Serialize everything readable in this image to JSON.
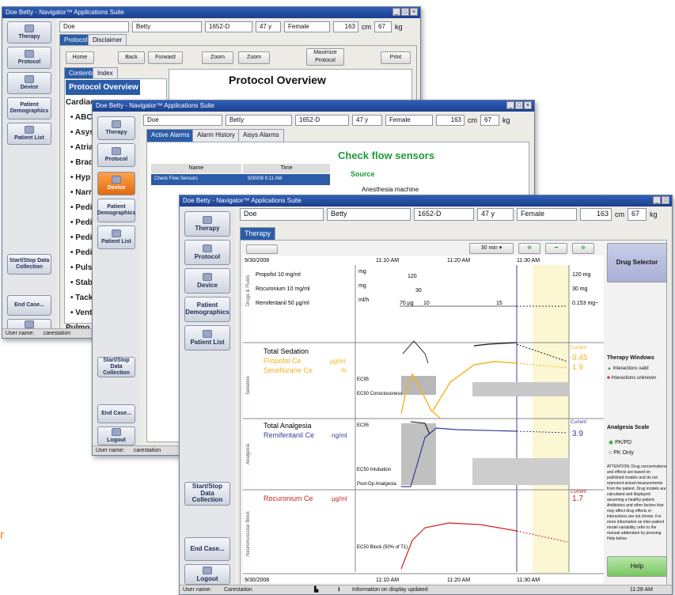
{
  "app_title": "Doe Betty - Navigator™ Applications Suite",
  "patient": {
    "last": "Doe",
    "first": "Betty",
    "id": "1652-D",
    "age": "47 y",
    "sex": "Female",
    "height": "163",
    "height_unit": "cm",
    "weight": "67",
    "weight_unit": "kg"
  },
  "sidebar": {
    "therapy": "Therapy",
    "protocol": "Protocol",
    "device": "Device",
    "demographics": "Patient Demographics",
    "patient_list": "Patient List",
    "start_stop": "Start/Stop Data Collection",
    "end_case": "End Case...",
    "logout": "Logout"
  },
  "w1": {
    "tab_protocol": "Protocol",
    "tab_disclaimer": "Disclaimer",
    "home": "Home",
    "back": "Back",
    "forward": "Forward",
    "zoom_in": "Zoom",
    "zoom_out": "Zoom",
    "maximize": "Maximize Protocol",
    "print": "Print",
    "tab_contents": "Contents",
    "tab_index": "Index",
    "heading": "Protocol Overview",
    "tree": [
      "Protocol Overview",
      "Cardiac",
      "• ABC",
      "• Asys",
      "• Atria",
      "• Brad",
      "• Hyp",
      "• Narr",
      "• Pedi",
      "• Pedi",
      "• Pedi",
      "• Pedi",
      "• Puls",
      "• Stab",
      "• Tack",
      "• Vent",
      "Pulmo"
    ],
    "status_label": "User name:",
    "status_user": "carestation"
  },
  "w2": {
    "tab_active": "Active Alarms",
    "tab_history": "Alarm History",
    "tab_aisys": "Aisys Alarms",
    "col_name": "Name",
    "col_time": "Time",
    "row_name": "Check Flow Sensors",
    "row_time": "9/30/08 9:11 AM",
    "heading": "Check flow sensors",
    "source_label": "Source",
    "source_value": "Anesthesia machine",
    "status_label": "User name:",
    "status_user": "carestation"
  },
  "w3": {
    "tab": "Therapy",
    "time_window": "30 min",
    "date": "9/30/2008",
    "time_ticks": [
      "11:10 AM",
      "11:20 AM",
      "11:30 AM"
    ],
    "drugs_section": "Drugs & Fluids",
    "drugs": [
      {
        "name": "Propofol 10 mg/ml",
        "unit": "mg",
        "current": "120 mg",
        "bolus": "120"
      },
      {
        "name": "Rocuronium 10 mg/ml",
        "unit": "mg",
        "current": "30 mg",
        "bolus": "30"
      },
      {
        "name": "Remifentanil 50 µg/ml",
        "unit": "ml/h",
        "current": "0.153 mg~",
        "rate1": "70 µg",
        "rate2": "10",
        "rate3": "15"
      }
    ],
    "sedation": {
      "section": "Sedation",
      "title": "Total Sedation",
      "drug1": "Propofol Ce",
      "drug1_unit": "µg/ml",
      "drug2": "Sevoflurane Ce",
      "drug2_unit": "%",
      "current_label": "Current",
      "value1": "0.45",
      "value2": "1.9",
      "ec95": "EC95",
      "ec50": "EC50 Consciousness"
    },
    "analgesia": {
      "section": "Analgesia",
      "title": "Total Analgesia",
      "drug": "Remifentanil Ce",
      "unit": "ng/ml",
      "current_label": "Current",
      "value": "3.9",
      "ec95": "EC95",
      "ec50": "EC50 Intubation",
      "postop": "Post-Op Analgesia"
    },
    "nmb": {
      "section": "Neuromuscular Block",
      "drug": "Rocuronium Ce",
      "unit": "µg/ml",
      "current_label": "Current",
      "value": "1.7",
      "ec50": "EC50 Block (50% of T1)"
    },
    "drug_selector": "Drug Selector",
    "therapy_windows": "Therapy Windows",
    "legend_valid": "Interactions valid",
    "legend_unknown": "Interactions unknown",
    "analgesia_scale": "Analgesia Scale",
    "radio_pkpd": "PK/PD",
    "radio_pk": "PK Only",
    "attention": "ATTENTION: Drug concentrations and effects are based on published models and do not represent actual measurements from the patient. Drug models are calculated and displayed assuming a healthy patient. Antibiotics and other factors that may affect drug effects or interactions are not shown. For more information on inter-patient model variability, refer to the manual addendum by pressing Help below.",
    "help": "Help",
    "status_label": "User name:",
    "status_user": "Carestation",
    "status_msg": "Information on display updated",
    "status_time": "11:28 AM"
  },
  "colors": {
    "propofol": "#f2b41c",
    "remi": "#3a3a9a",
    "roc": "#d02020",
    "accent": "#2c5ca8",
    "therapy_window": "#fbf7d2"
  }
}
